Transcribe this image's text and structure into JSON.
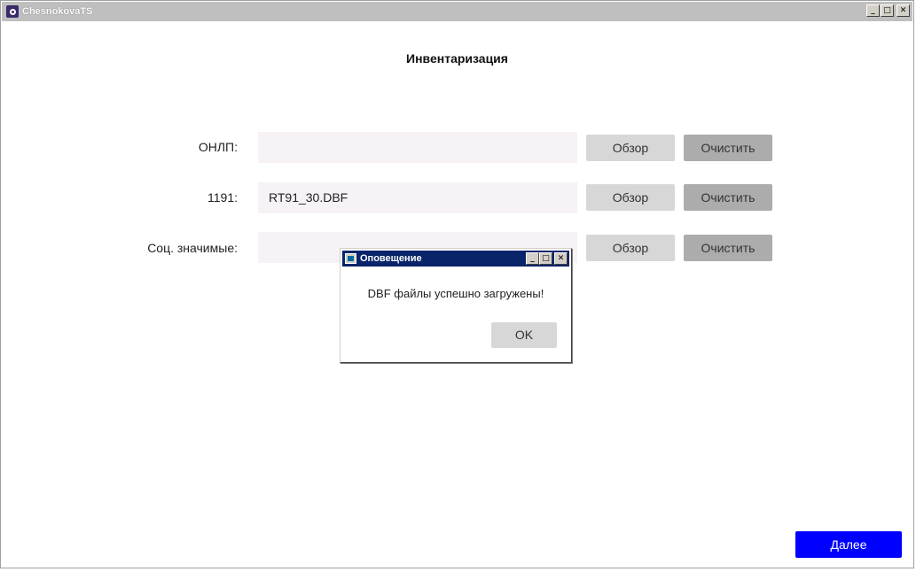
{
  "window": {
    "title": "ChesnokovaTS",
    "controls": {
      "minimize": "_",
      "maximize": "□",
      "close": "✕"
    }
  },
  "page": {
    "title": "Инвентаризация"
  },
  "rows": [
    {
      "label": "ОНЛП:",
      "value": "",
      "browse": "Обзор",
      "clear": "Очистить"
    },
    {
      "label": "1191:",
      "value": "RT91_30.DBF",
      "browse": "Обзор",
      "clear": "Очистить"
    },
    {
      "label": "Соц. значимые:",
      "value": "",
      "browse": "Обзор",
      "clear": "Очистить"
    }
  ],
  "footer": {
    "next_label": "Далее"
  },
  "dialog": {
    "title": "Оповещение",
    "message": "DBF файлы успешно загружены!",
    "ok_label": "OK",
    "controls": {
      "minimize": "_",
      "maximize": "□",
      "close": "✕"
    }
  },
  "colors": {
    "next_button": "#0000ff",
    "dialog_titlebar": "#0a246a",
    "field_bg": "#f6f2f6",
    "browse_bg": "#d7d7d7",
    "clear_bg": "#acacac"
  }
}
